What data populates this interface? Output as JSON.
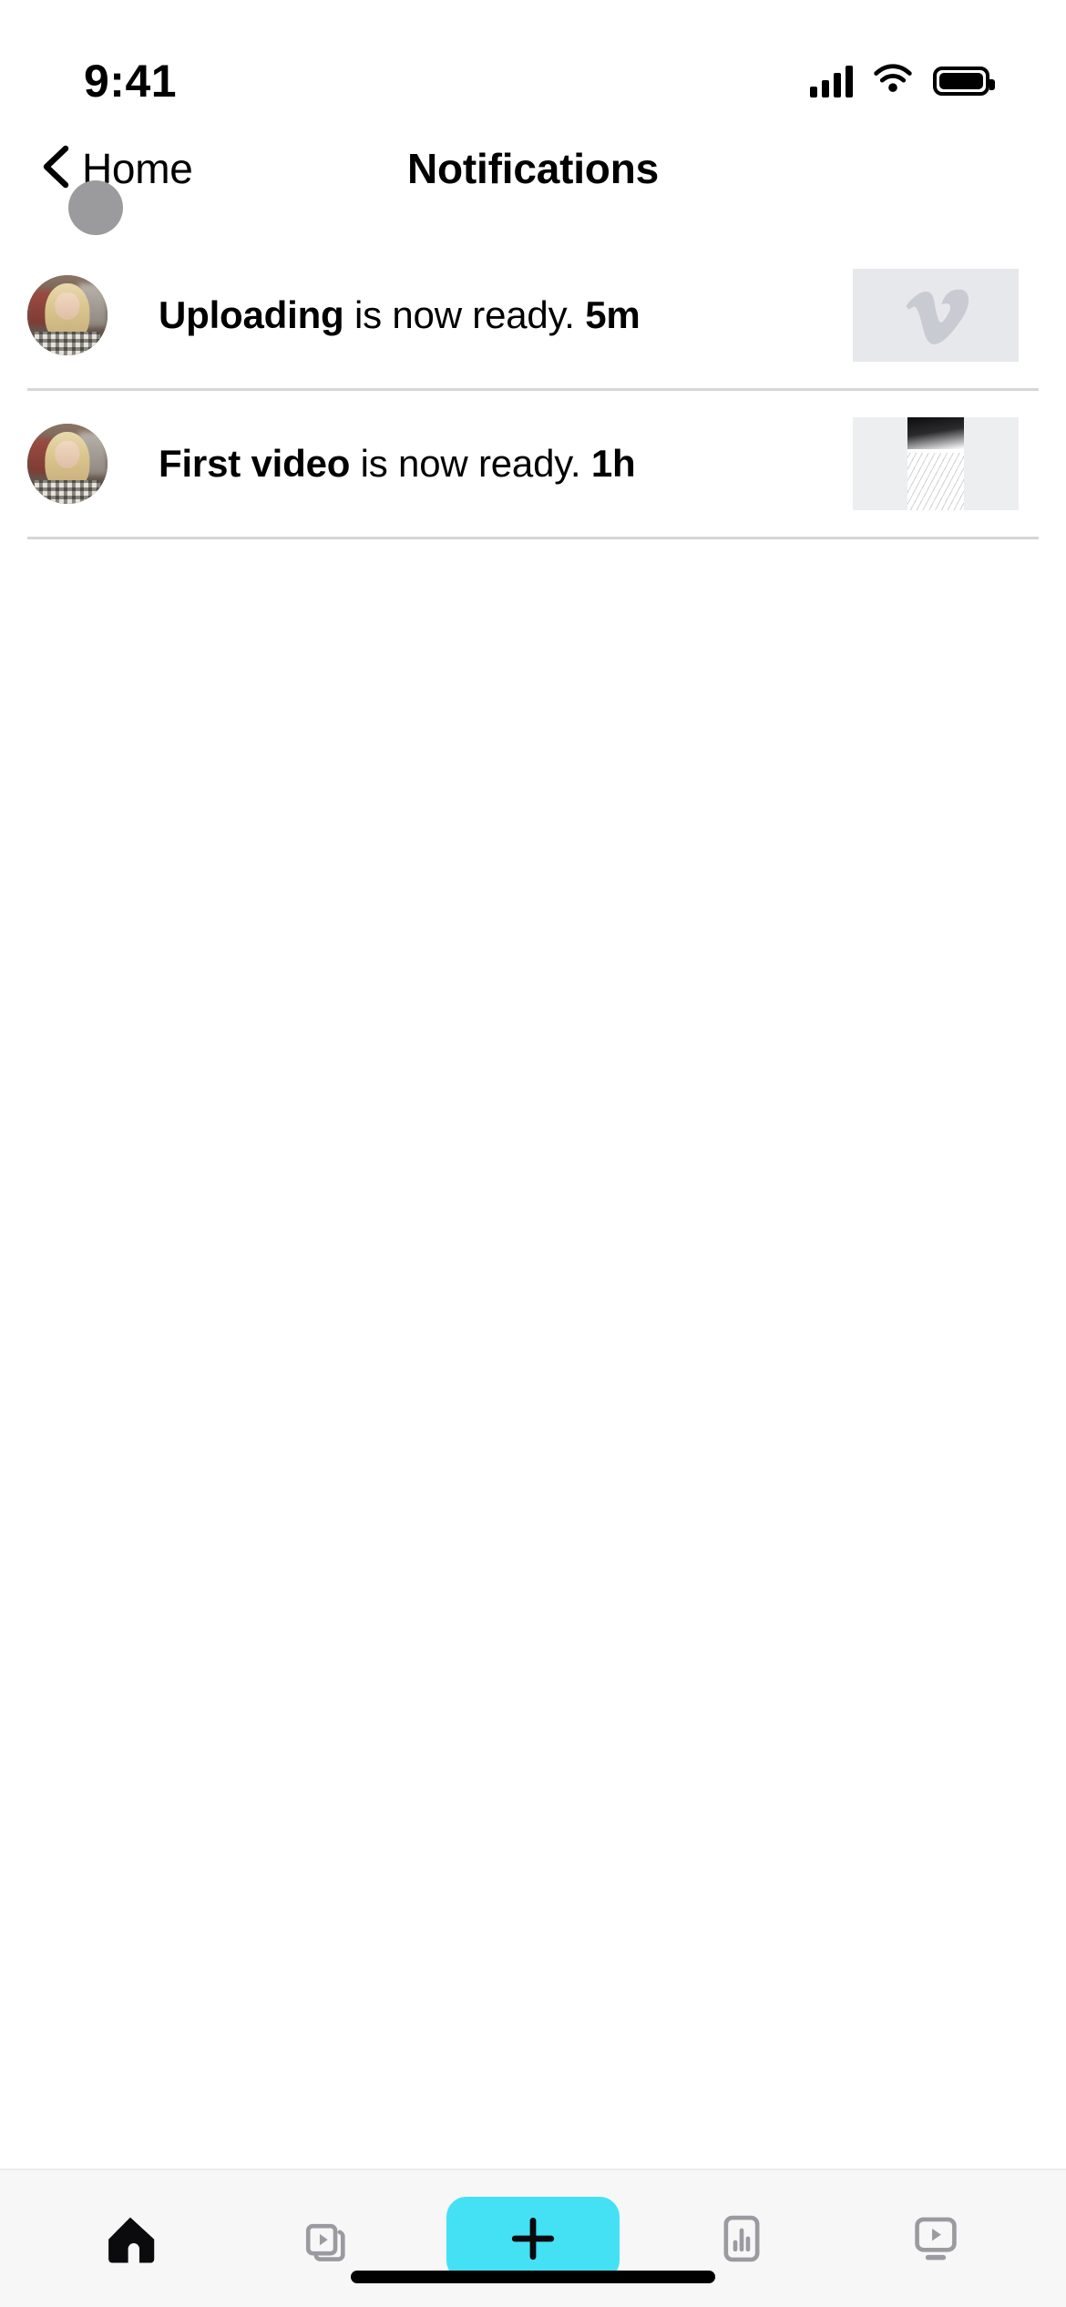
{
  "status_bar": {
    "time": "9:41",
    "signal_icon": "cellular-signal-icon",
    "wifi_icon": "wifi-icon",
    "battery_icon": "battery-icon"
  },
  "nav_bar": {
    "back_icon": "chevron-left-icon",
    "back_label": "Home",
    "title": "Notifications",
    "touch_indicator": "touch-point-indicator"
  },
  "notifications": [
    {
      "avatar": "user-avatar",
      "subject": "Uploading",
      "message": " is now ready. ",
      "time": "5m",
      "thumbnail_type": "vimeo-logo-placeholder"
    },
    {
      "avatar": "user-avatar",
      "subject": "First video",
      "message": " is now ready. ",
      "time": "1h",
      "thumbnail_type": "video-still"
    }
  ],
  "tab_bar": {
    "items": [
      {
        "icon": "home-icon",
        "active": true
      },
      {
        "icon": "video-library-icon",
        "active": false
      },
      {
        "icon": "plus-icon",
        "active": false
      },
      {
        "icon": "stats-bar-chart-icon",
        "active": false
      },
      {
        "icon": "watch-tv-icon",
        "active": false
      }
    ],
    "create_button_color": "#44E1F5"
  },
  "home_indicator": "home-indicator"
}
